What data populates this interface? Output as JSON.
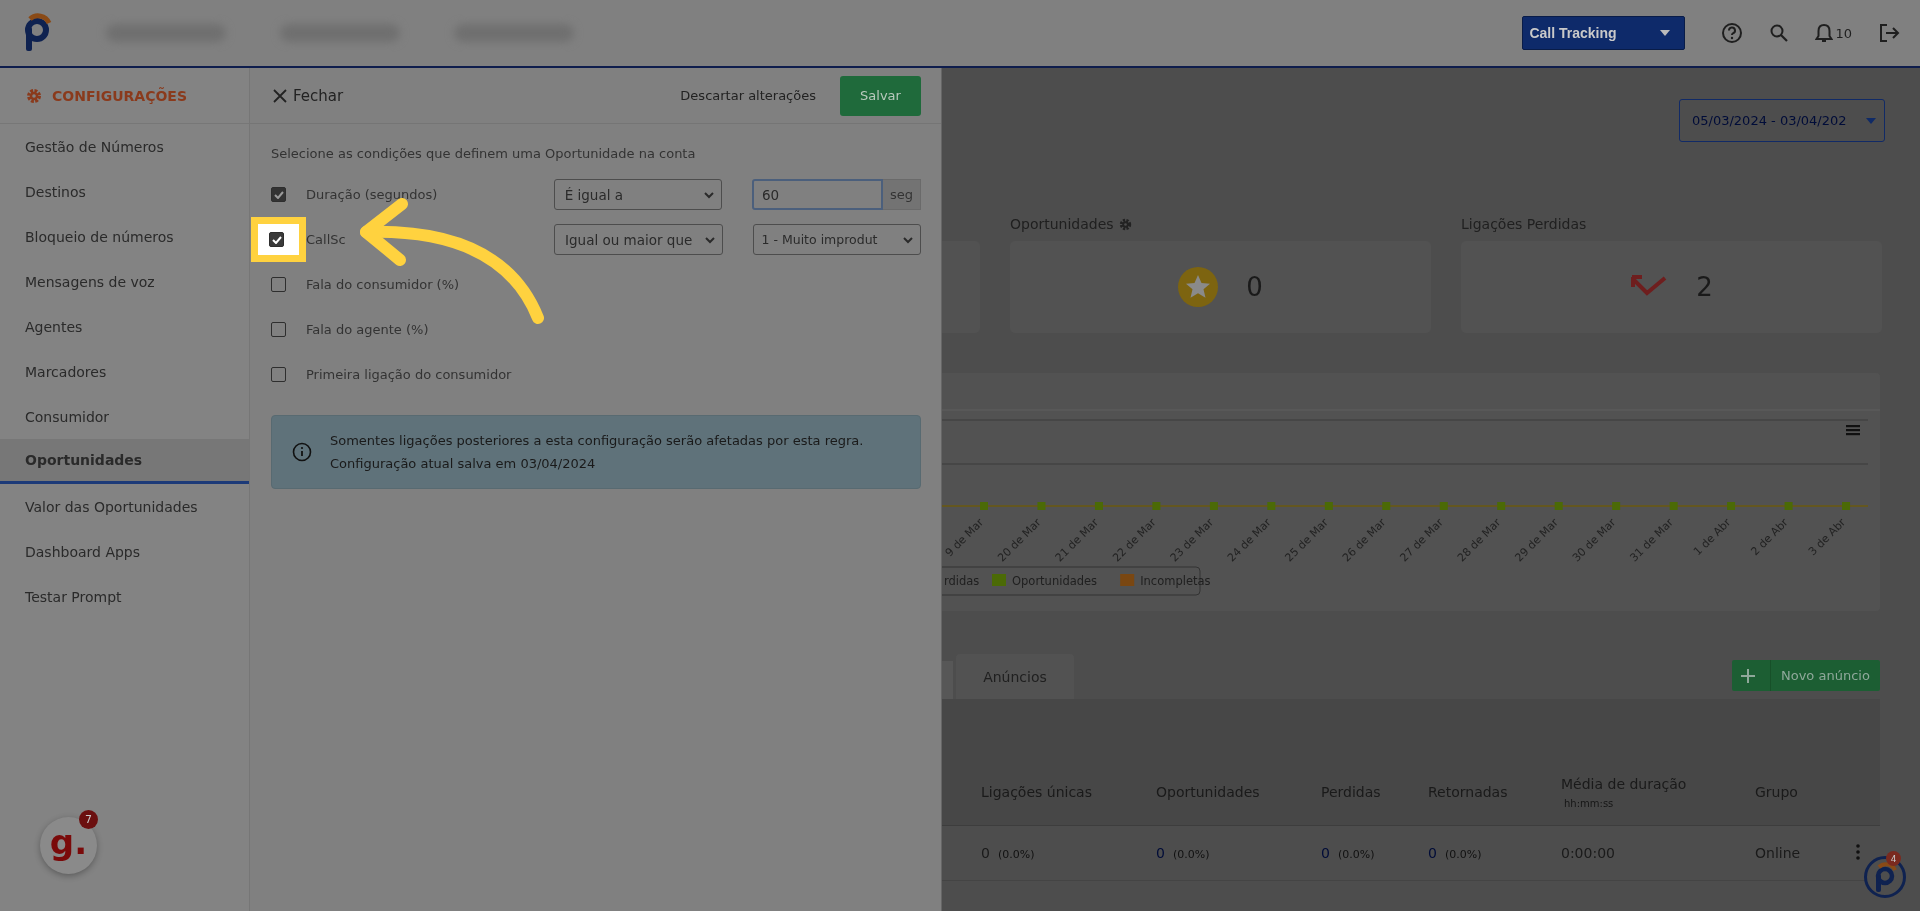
{
  "top_bar": {
    "product_select": "Call Tracking",
    "notifications_count": "10"
  },
  "sidebar": {
    "title": "CONFIGURAÇÕES",
    "items": [
      {
        "label": "Gestão de Números",
        "selected": false
      },
      {
        "label": "Destinos",
        "selected": false
      },
      {
        "label": "Bloqueio de números",
        "selected": false
      },
      {
        "label": "Mensagens de voz",
        "selected": false
      },
      {
        "label": "Agentes",
        "selected": false
      },
      {
        "label": "Marcadores",
        "selected": false
      },
      {
        "label": "Consumidor",
        "selected": false
      },
      {
        "label": "Oportunidades",
        "selected": true
      },
      {
        "label": "Valor das Oportunidades",
        "selected": false
      },
      {
        "label": "Dashboard Apps",
        "selected": false
      },
      {
        "label": "Testar Prompt",
        "selected": false
      }
    ]
  },
  "panel": {
    "close": "Fechar",
    "discard": "Descartar alterações",
    "save": "Salvar",
    "instruction": "Selecione as condições que definem uma Oportunidade na conta",
    "conditions": [
      {
        "label": "Duração (segundos)",
        "checked": true,
        "highlighted": false,
        "operator": "É igual a",
        "value": "60",
        "unit": "seg"
      },
      {
        "label": "CallSc",
        "checked": true,
        "highlighted": true,
        "operator": "Igual ou maior que",
        "option": "1 - Muito improdut"
      },
      {
        "label": "Fala do consumidor (%)",
        "checked": false,
        "highlighted": false
      },
      {
        "label": "Fala do agente (%)",
        "checked": false,
        "highlighted": false
      },
      {
        "label": "Primeira ligação do consumidor",
        "checked": false,
        "highlighted": false
      }
    ],
    "notice": [
      "Somentes ligações posteriores a esta configuração serão afetadas por esta regra.",
      "Configuração atual salva em 03/04/2024"
    ]
  },
  "dashboard": {
    "date_range": "05/03/2024 - 03/04/202",
    "stats": [
      {
        "kind": "opportunities",
        "label": "Oportunidades",
        "value": "0"
      },
      {
        "kind": "missed",
        "label": "Ligações Perdidas",
        "value": "2"
      }
    ],
    "chart": {
      "x_labels": [
        "9 de Mar",
        "20 de Mar",
        "21 de Mar",
        "22 de Mar",
        "23 de Mar",
        "24 de Mar",
        "25 de Mar",
        "26 de Mar",
        "27 de Mar",
        "28 de Mar",
        "29 de Mar",
        "30 de Mar",
        "31 de Mar",
        "1 de Abr",
        "2 de Abr",
        "3 de Abr"
      ],
      "legend": [
        {
          "label": "rdidas"
        },
        {
          "label": "Oportunidades",
          "color": "#4b6a06"
        },
        {
          "label": "Incompletas",
          "color": "#7a4712"
        }
      ]
    },
    "tabs": [
      {
        "label": "Anúncios",
        "selected": true
      }
    ],
    "new_button": "Novo anúncio",
    "table": {
      "columns": [
        {
          "label": "Ligações únicas"
        },
        {
          "label": "Oportunidades"
        },
        {
          "label": "Perdidas"
        },
        {
          "label": "Retornadas"
        },
        {
          "label": "Média de duração",
          "sublabel": "hh:mm:ss"
        },
        {
          "label": "Grupo"
        }
      ],
      "rows": [
        {
          "cells": [
            {
              "value": "0",
              "pct": "(0.0%)",
              "link": false
            },
            {
              "value": "0",
              "pct": "(0.0%)",
              "link": true
            },
            {
              "value": "0",
              "pct": "(0.0%)",
              "link": true
            },
            {
              "value": "0",
              "pct": "(0.0%)",
              "link": true
            },
            {
              "value": "0:00:00"
            },
            {
              "value": "Online"
            }
          ]
        }
      ]
    }
  },
  "widgets": {
    "left_logo": "g.",
    "left_badge": "7",
    "right_badge": "4"
  }
}
